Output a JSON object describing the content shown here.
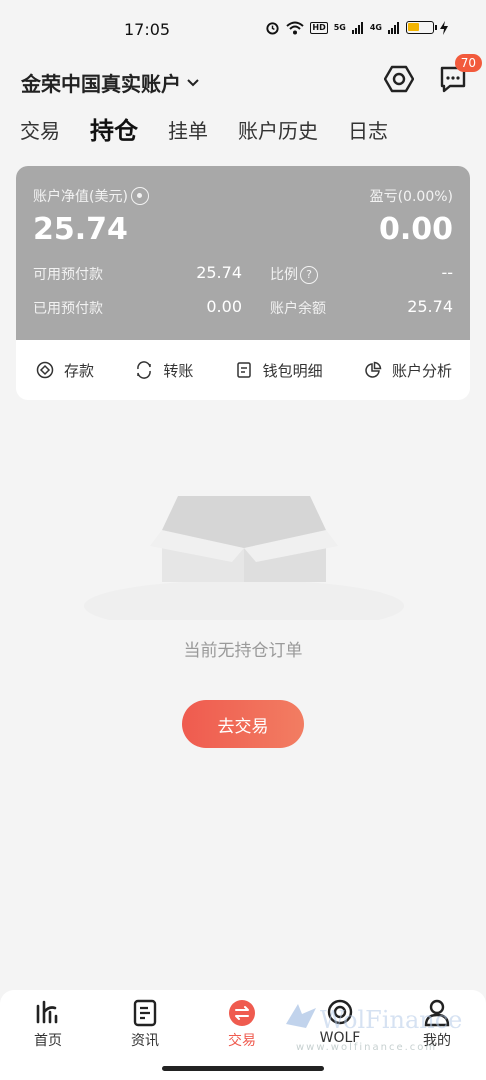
{
  "status_bar": {
    "time": "17:05",
    "hd": "HD",
    "net1": "5G",
    "net2": "4G"
  },
  "header": {
    "account_title": "金荣中国真实账户",
    "settings_icon": "gear-hex-icon",
    "messages_icon": "message-icon",
    "message_badge": "70"
  },
  "tabs": [
    {
      "label": "交易",
      "active": false
    },
    {
      "label": "持仓",
      "active": true
    },
    {
      "label": "挂单",
      "active": false
    },
    {
      "label": "账户历史",
      "active": false
    },
    {
      "label": "日志",
      "active": false
    }
  ],
  "account": {
    "equity_label": "账户净值(美元)",
    "equity_value": "25.74",
    "pnl_label": "盈亏(0.00%)",
    "pnl_value": "0.00",
    "available_margin_label": "可用预付款",
    "available_margin_value": "25.74",
    "ratio_label": "比例",
    "ratio_value": "--",
    "used_margin_label": "已用预付款",
    "used_margin_value": "0.00",
    "balance_label": "账户余额",
    "balance_value": "25.74"
  },
  "actions": [
    {
      "label": "存款",
      "icon": "deposit-icon"
    },
    {
      "label": "转账",
      "icon": "transfer-icon"
    },
    {
      "label": "钱包明细",
      "icon": "wallet-detail-icon"
    },
    {
      "label": "账户分析",
      "icon": "pie-chart-icon"
    }
  ],
  "empty_state": {
    "text": "当前无持仓订单",
    "button_label": "去交易"
  },
  "bottom_nav": [
    {
      "label": "首页",
      "icon": "home-logo-icon",
      "active": false
    },
    {
      "label": "资讯",
      "icon": "news-icon",
      "active": false
    },
    {
      "label": "交易",
      "icon": "trade-icon",
      "active": true
    },
    {
      "label": "WOLF",
      "icon": "wolf-icon",
      "active": false
    },
    {
      "label": "我的",
      "icon": "profile-icon",
      "active": false
    }
  ],
  "watermark": {
    "brand": "WolFinance",
    "url": "www.wolfinance.com"
  },
  "colors": {
    "accent": "#ef5b4f",
    "card_gray": "#a8a8a8",
    "badge": "#f25a3c"
  }
}
